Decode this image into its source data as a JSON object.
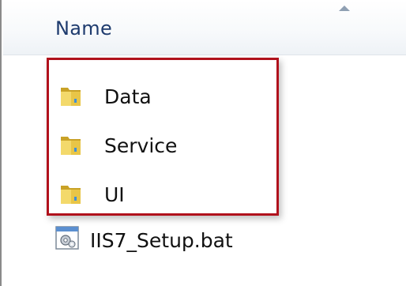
{
  "header": {
    "name_label": "Name"
  },
  "items": [
    {
      "label": "Data",
      "icon": "folder-icon"
    },
    {
      "label": "Service",
      "icon": "folder-icon"
    },
    {
      "label": "UI",
      "icon": "folder-icon"
    },
    {
      "label": "IIS7_Setup.bat",
      "icon": "batch-file-icon"
    }
  ],
  "colors": {
    "highlight_border": "#b0111c",
    "header_text": "#1e3b6e",
    "folder_front": "#e8c547",
    "folder_back": "#c9a227"
  }
}
